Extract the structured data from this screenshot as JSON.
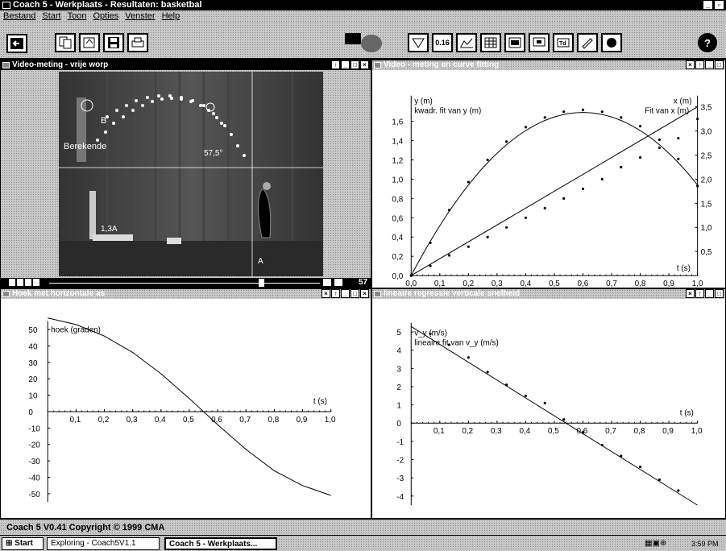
{
  "window": {
    "title": "Coach 5 - Werkplaats - Resultaten: basketbal"
  },
  "menu": [
    "Bestand",
    "Start",
    "Toon",
    "Opties",
    "Venster",
    "Help"
  ],
  "toolbar": {
    "scale_label": "0.16",
    "help_label": "?"
  },
  "video": {
    "title": "Video-meting - vrije worp",
    "label_b": "B",
    "label_calc": "Berekende",
    "label_angle": "57,5°",
    "label_ref": "1,3A",
    "label_a": "A",
    "frame": "57"
  },
  "w2": {
    "title": "Video - meting en curve fitting"
  },
  "w3": {
    "title": "Hoek met horizontale as"
  },
  "w4": {
    "title": "lineaire regressie verticale snelheid"
  },
  "status": {
    "text": "Coach 5 V0.41 Copyright © 1999 CMA"
  },
  "taskbar": {
    "start": "Start",
    "task1": "Exploring - Coach5V1.1",
    "task2": "Coach 5 - Werkplaats...",
    "clock": "3:59 PM"
  },
  "chart_data": [
    {
      "type": "scatter",
      "title": "",
      "y_label": "y (m)",
      "y_label2": "kwadr. fit van y (m)",
      "x_label": "x (m)",
      "x_label2": "Fit van x (m)",
      "xlabel": "t (s)",
      "xlim": [
        0,
        1.0
      ],
      "ylim": [
        0,
        1.8
      ],
      "y2lim": [
        0,
        3.6
      ],
      "x_ticks": [
        "0,0",
        "0,1",
        "0,2",
        "0,3",
        "0,4",
        "0,5",
        "0,6",
        "0,7",
        "0,8",
        "0,9",
        "1,0"
      ],
      "y_ticks": [
        "0,0",
        "0,2",
        "0,4",
        "0,6",
        "0,8",
        "1,0",
        "1,2",
        "1,4",
        "1,6"
      ],
      "y2_ticks": [
        "0,5",
        "1,0",
        "1,5",
        "2,0",
        "2,5",
        "3,0",
        "3,5"
      ],
      "series": [
        {
          "name": "y (m)",
          "t": [
            0.0,
            0.067,
            0.133,
            0.2,
            0.267,
            0.333,
            0.4,
            0.467,
            0.533,
            0.6,
            0.667,
            0.733,
            0.8,
            0.867,
            0.933,
            1.0
          ],
          "values": [
            0.0,
            0.34,
            0.68,
            0.97,
            1.2,
            1.39,
            1.54,
            1.64,
            1.7,
            1.72,
            1.7,
            1.64,
            1.55,
            1.41,
            1.21,
            0.93
          ]
        },
        {
          "name": "x (m)",
          "axis": "right",
          "t": [
            0.0,
            0.067,
            0.133,
            0.2,
            0.267,
            0.333,
            0.4,
            0.467,
            0.533,
            0.6,
            0.667,
            0.733,
            0.8,
            0.867,
            0.933,
            1.0
          ],
          "values": [
            0.0,
            0.2,
            0.42,
            0.6,
            0.8,
            1.0,
            1.2,
            1.4,
            1.6,
            1.8,
            2.0,
            2.25,
            2.45,
            2.65,
            2.85,
            3.25
          ]
        }
      ]
    },
    {
      "type": "line",
      "title": "",
      "ylabel": "hoek (graden)",
      "xlabel": "t (s)",
      "xlim": [
        0,
        1.0
      ],
      "ylim": [
        -55,
        55
      ],
      "x_ticks": [
        "0,1",
        "0,2",
        "0,3",
        "0,4",
        "0,5",
        "0,6",
        "0,7",
        "0,8",
        "0,9",
        "1,0"
      ],
      "y_ticks": [
        "50",
        "40",
        "30",
        "20",
        "10",
        "0",
        "-10",
        "-20",
        "-30",
        "-40",
        "-50"
      ],
      "series": [
        {
          "name": "hoek (graden)",
          "t": [
            0.0,
            0.1,
            0.2,
            0.3,
            0.4,
            0.5,
            0.55,
            0.6,
            0.7,
            0.8,
            0.9,
            1.0
          ],
          "values": [
            57,
            53,
            46,
            36,
            23,
            8,
            0,
            -8,
            -23,
            -36,
            -45,
            -51
          ]
        }
      ]
    },
    {
      "type": "scatter",
      "title": "",
      "ylabel": "v_y (m/s)",
      "ylabel2": "lineaire fit van v_y (m/s)",
      "xlabel": "t (s)",
      "xlim": [
        0,
        1.0
      ],
      "ylim": [
        -4.5,
        5.5
      ],
      "x_ticks": [
        "0,1",
        "0,2",
        "0,3",
        "0,4",
        "0,5",
        "0,6",
        "0,7",
        "0,8",
        "0,9",
        "1,0"
      ],
      "y_ticks": [
        "5",
        "4",
        "3",
        "2",
        "1",
        "0",
        "-1",
        "-2",
        "-3",
        "-4"
      ],
      "fit": {
        "t": [
          0.0,
          1.0
        ],
        "values": [
          5.3,
          -4.5
        ]
      },
      "series": [
        {
          "name": "v_y (m/s)",
          "t": [
            0.067,
            0.133,
            0.2,
            0.267,
            0.333,
            0.4,
            0.467,
            0.533,
            0.6,
            0.667,
            0.733,
            0.8,
            0.867,
            0.933
          ],
          "values": [
            4.9,
            4.3,
            3.6,
            2.8,
            2.1,
            1.5,
            1.1,
            0.2,
            -0.5,
            -1.2,
            -1.8,
            -2.4,
            -3.1,
            -3.7
          ]
        }
      ]
    }
  ]
}
